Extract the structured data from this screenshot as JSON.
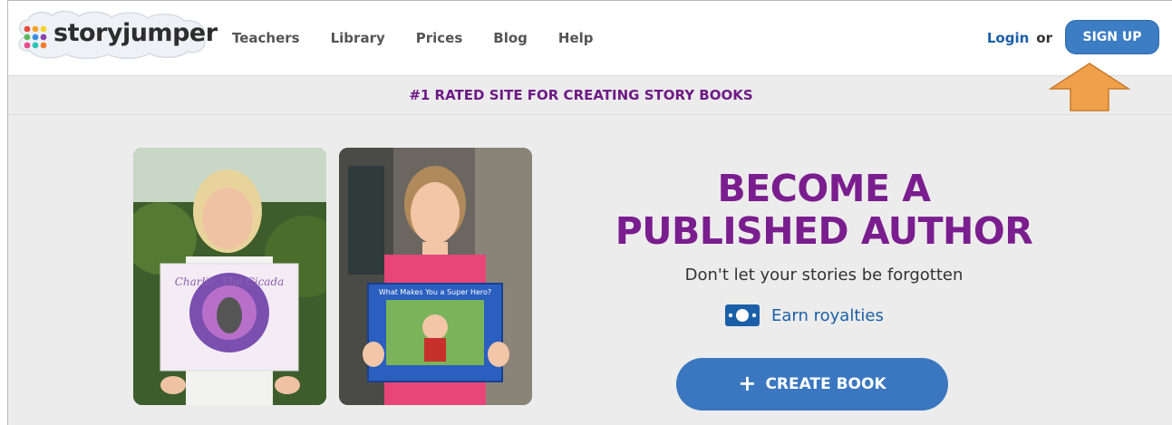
{
  "header": {
    "logo": {
      "part1": "story",
      "part2": "jumper"
    },
    "nav": [
      {
        "label": "Teachers"
      },
      {
        "label": "Library"
      },
      {
        "label": "Prices"
      },
      {
        "label": "Blog"
      },
      {
        "label": "Help"
      }
    ],
    "login_label": "Login",
    "or_label": "or",
    "signup_label": "SIGN UP"
  },
  "banner": {
    "text": "#1 RATED SITE FOR CREATING STORY BOOKS"
  },
  "hero": {
    "photos": [
      {
        "book_title": "Charlie, The Cicada"
      },
      {
        "book_title": "What Makes You a Super Hero?"
      }
    ],
    "headline_line1": "BECOME A",
    "headline_line2": "PUBLISHED AUTHOR",
    "subline": "Don't let your stories be forgotten",
    "royalties_label": "Earn royalties",
    "create_button_label": "CREATE BOOK"
  },
  "colors": {
    "brand_purple": "#7a1d8e",
    "link_blue": "#1a5fa8",
    "button_blue": "#3a77c0",
    "arrow_orange": "#f0a04b"
  },
  "icons": {
    "logo_dots": "colored-dots-icon",
    "royalties": "money-icon",
    "create_plus": "plus-icon",
    "annotation_arrow": "up-arrow-icon"
  }
}
